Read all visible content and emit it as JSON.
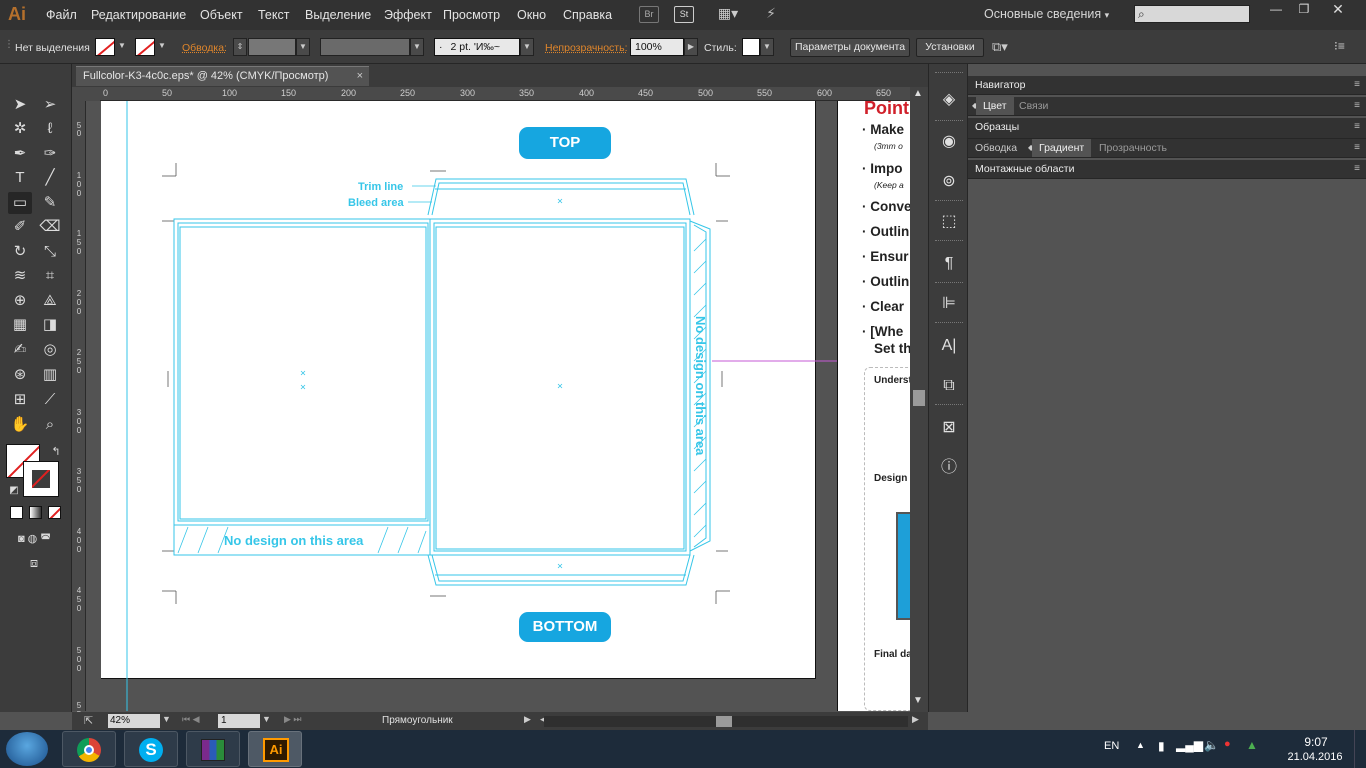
{
  "menubar": {
    "logo": "Ai",
    "items": [
      "Файл",
      "Редактирование",
      "Объект",
      "Текст",
      "Выделение",
      "Эффект",
      "Просмотр",
      "Окно",
      "Справка"
    ],
    "bridge": "Br",
    "stock": "St",
    "workspace": "Основные сведения",
    "search_placeholder": ""
  },
  "control": {
    "selection": "Нет выделения",
    "stroke_label": "Обводка:",
    "brush": "2 pt. 'И‰~",
    "brush_dot": "·",
    "opacity_label": "Непрозрачность:",
    "opacity_value": "100%",
    "style_label": "Стиль:",
    "doc_setup": "Параметры документа",
    "prefs": "Установки"
  },
  "document": {
    "tab_title": "Fullcolor-K3-4c0c.eps* @ 42% (CMYK/Просмотр)",
    "close": "×"
  },
  "ruler": {
    "h": [
      "0",
      "50",
      "100",
      "150",
      "200",
      "250",
      "300",
      "350",
      "400",
      "450",
      "500",
      "550",
      "600",
      "650"
    ],
    "v": [
      "5",
      "0",
      "100",
      "150",
      "200",
      "250",
      "300",
      "350",
      "400",
      "450",
      "500",
      "550"
    ]
  },
  "artwork": {
    "top_label": "TOP",
    "bottom_label": "BOTTOM",
    "trim_line": "Trim line",
    "bleed_area": "Bleed area",
    "no_design": "No design on this area",
    "no_design_vertical": "No design on this area"
  },
  "guide_doc": {
    "title": "Point",
    "bullets": [
      "Make",
      "Impo",
      "Conve",
      "Outlin",
      "Ensur",
      "Outlin",
      "Clear",
      "[Whe",
      "Set th"
    ],
    "sub1": "(3mm o",
    "sub2": "(Keep a",
    "understand": "Underst",
    "design": "Design",
    "final": "Final da"
  },
  "status": {
    "zoom": "42%",
    "page": "1",
    "tool": "Прямоугольник"
  },
  "panels": {
    "navigator": "Навигатор",
    "color": "Цвет",
    "links": "Связи",
    "swatches": "Образцы",
    "stroke": "Обводка",
    "gradient": "Градиент",
    "transparency": "Прозрачность",
    "artboards": "Монтажные области"
  },
  "taskbar": {
    "lang": "EN",
    "time": "9:07",
    "date": "21.04.2016",
    "ai_label": "Ai"
  },
  "colors": {
    "accent_orange": "#e0862b",
    "guide_cyan": "#36c6e8",
    "pill_blue": "#16a6e0",
    "guide_red": "#d0202a"
  }
}
